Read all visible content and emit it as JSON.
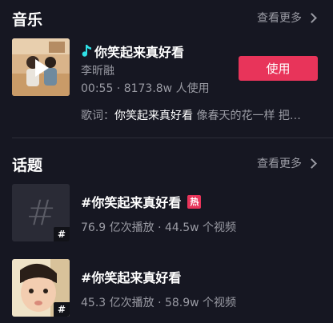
{
  "music_section": {
    "title": "音乐",
    "see_more": "查看更多",
    "item": {
      "title": "你笑起来真好看",
      "artist": "李昕融",
      "stats": "00:55 · 8173.8w 人使用",
      "use_label": "使用",
      "lyrics_prefix": "歌词：",
      "lyrics_highlight": "你笑起来真好看",
      "lyrics_rest": " 像春天的花一样 把…"
    }
  },
  "topic_section": {
    "title": "话题",
    "see_more": "查看更多",
    "items": [
      {
        "title": "#你笑起来真好看",
        "hot_label": "热",
        "stats": "76.9 亿次播放 · 44.5w 个视频",
        "badge": "#",
        "placeholder": "#"
      },
      {
        "title": "#你笑起来真好看",
        "stats": "45.3 亿次播放 · 58.9w 个视频",
        "badge": "#"
      }
    ]
  },
  "colors": {
    "background": "#161722",
    "accent": "#e8345a",
    "secondary_text": "#9a9ba4"
  }
}
